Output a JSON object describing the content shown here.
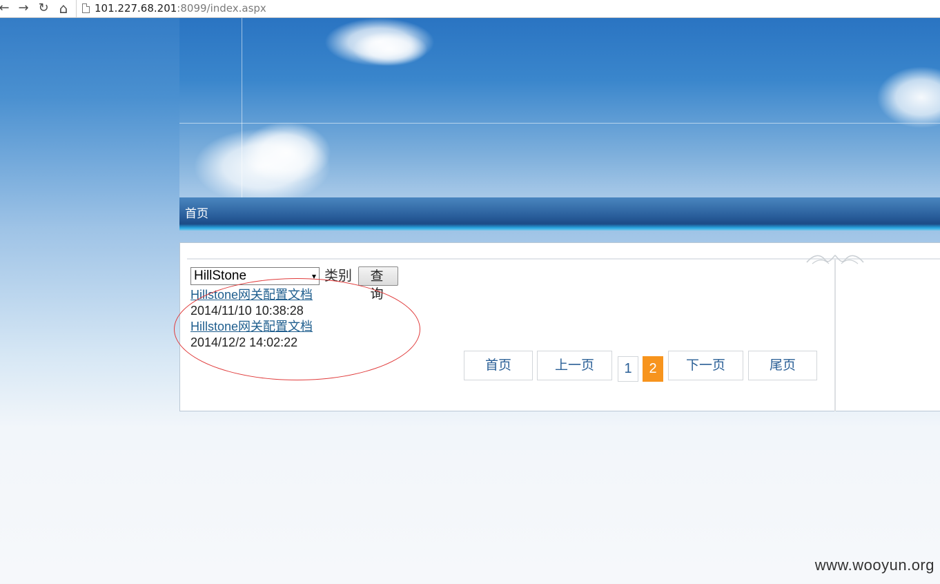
{
  "browser": {
    "back_icon": "←",
    "forward_icon": "→",
    "reload_icon": "↻",
    "home_icon": "⌂",
    "url_host": "101.227.68.201",
    "url_rest": ":8099/index.aspx"
  },
  "nav": {
    "home_label": "首页"
  },
  "filter": {
    "selected_category": "HillStone",
    "category_label": "类别",
    "query_button": "查 询"
  },
  "documents": [
    {
      "title": "Hillstone网关配置文档",
      "date": "2014/11/10 10:38:28"
    },
    {
      "title": "Hillstone网关配置文档",
      "date": "2014/12/2 14:02:22"
    }
  ],
  "pagination": {
    "first": "首页",
    "prev": "上一页",
    "pages": [
      "1",
      "2"
    ],
    "current_page": "2",
    "next": "下一页",
    "last": "尾页"
  },
  "watermark": "www.wooyun.org",
  "colors": {
    "active_page": "#f7941d",
    "link": "#1f5e8e",
    "annotation_ellipse": "#e03a3a"
  }
}
